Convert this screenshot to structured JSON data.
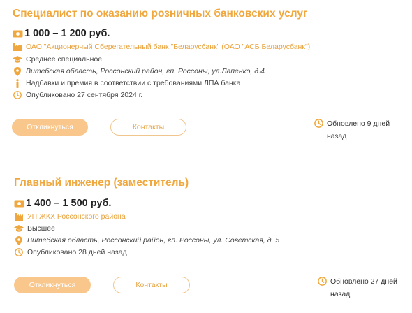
{
  "vacancies": [
    {
      "title": "Специалист по оказанию розничных банковских услуг",
      "salary": "1 000 – 1 200 руб.",
      "company": "ОАО \"Акционерный Сберегательный банк \"Беларусбанк\" (ОАО \"АСБ Беларусбанк\")",
      "education": "Среднее специальное",
      "address": "Витебская область, Россонский район, гп. Россоны, ул.Лапенко, д.4",
      "info": "Надбавки и премия в соответствии с требованиями ЛПА банка",
      "published": "Опубликовано 27 сентября 2024 г.",
      "respond_label": "Откликнуться",
      "contacts_label": "Контакты",
      "updated_line1": "Обновлено 9 дней",
      "updated_line2": "назад"
    },
    {
      "title": "Главный инженер (заместитель)",
      "salary": "1 400 – 1 500 руб.",
      "company": "УП ЖКХ Россонского района",
      "education": "Высшее",
      "address": "Витебская область, Россонский район, гп. Россоны, ул. Советская, д. 5",
      "published": "Опубликовано 28 дней назад",
      "respond_label": "Откликнуться",
      "contacts_label": "Контакты",
      "updated_line1": "Обновлено 27 дней",
      "updated_line2": "назад"
    }
  ],
  "icons": {
    "salary": "money-icon",
    "company": "building-icon",
    "education": "graduation-cap-icon",
    "address": "location-pin-icon",
    "info": "info-icon",
    "published": "clock-icon",
    "updated": "clock-icon"
  },
  "colors": {
    "accent": "#f0a83e",
    "button_primary": "#f9c78b",
    "button_border": "#f1c68e"
  }
}
